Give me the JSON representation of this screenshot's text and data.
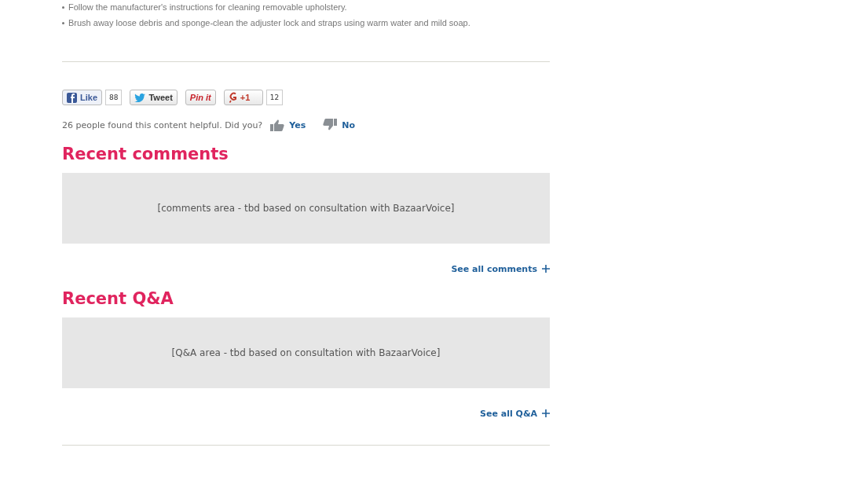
{
  "care_list": [
    "Follow the manufacturer's instructions for cleaning removable upholstery.",
    "Brush away loose debris and sponge-clean the adjuster lock and straps using warm water and mild soap."
  ],
  "share_buttons": [
    {
      "kind": "facebook",
      "label": "Like",
      "count": "88"
    },
    {
      "kind": "twitter",
      "label": "Tweet"
    },
    {
      "kind": "pinterest",
      "label": "Pin it"
    },
    {
      "kind": "google",
      "label": "+1",
      "count": "12"
    }
  ],
  "helpful": {
    "text": "26 people found this content helpful. Did you?",
    "yes": "Yes",
    "no": "No"
  },
  "sections": [
    {
      "title": "Recent comments",
      "placeholder_text": "[comments area - tbd based on consultation with BazaarVoice]",
      "link": "See all comments"
    },
    {
      "title": "Recent Q&A",
      "placeholder_text": "[Q&A area - tbd based on consultation with BazaarVoice]",
      "link": "See all Q&A"
    }
  ]
}
